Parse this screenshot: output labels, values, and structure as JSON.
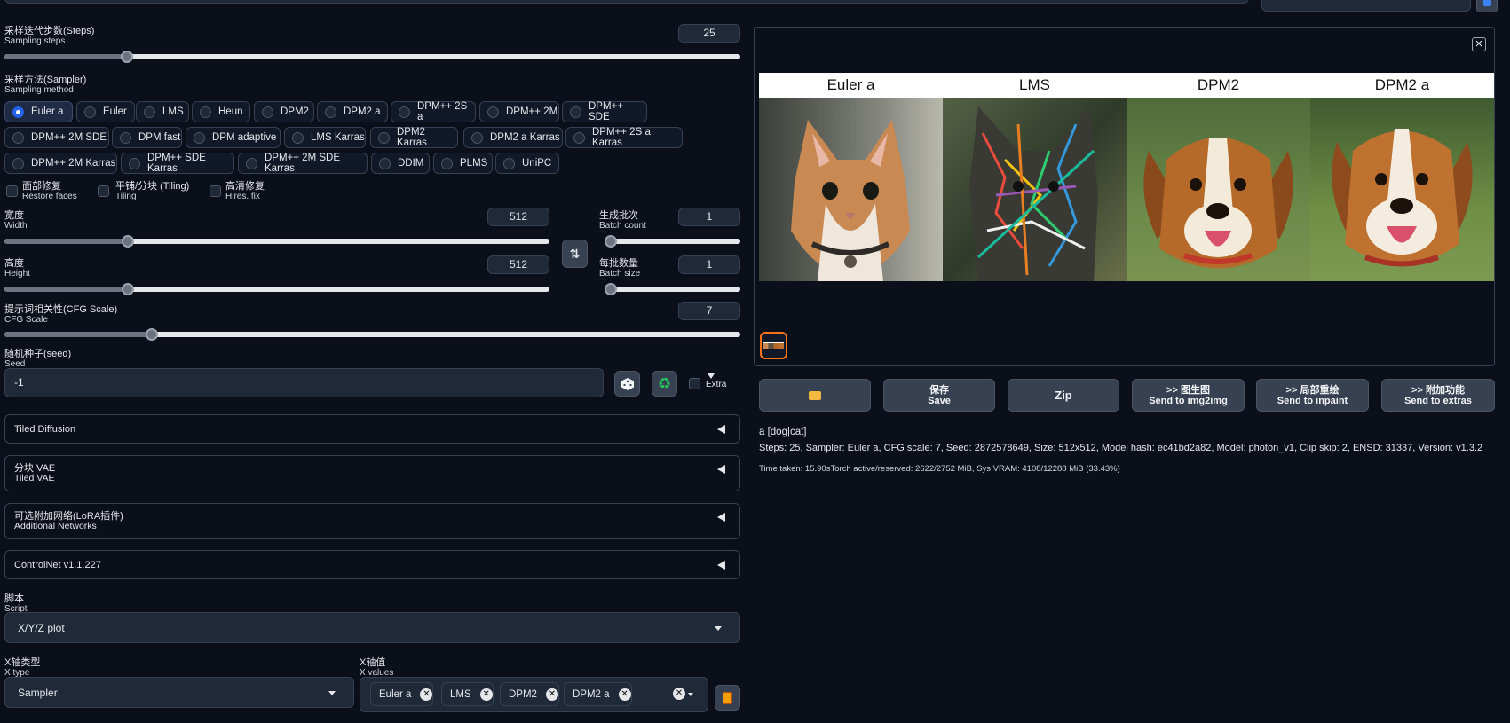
{
  "steps": {
    "label_cn": "采样迭代步数(Steps)",
    "label_en": "Sampling steps",
    "value": "25",
    "fraction": 0.167
  },
  "sampler": {
    "label_cn": "采样方法(Sampler)",
    "label_en": "Sampling method",
    "options": [
      "Euler a",
      "Euler",
      "LMS",
      "Heun",
      "DPM2",
      "DPM2 a",
      "DPM++ 2S a",
      "DPM++ 2M",
      "DPM++ SDE",
      "DPM++ 2M SDE",
      "DPM fast",
      "DPM adaptive",
      "LMS Karras",
      "DPM2 Karras",
      "DPM2 a Karras",
      "DPM++ 2S a Karras",
      "DPM++ 2M Karras",
      "DPM++ SDE Karras",
      "DPM++ 2M SDE Karras",
      "DDIM",
      "PLMS",
      "UniPC"
    ],
    "selected": "Euler a"
  },
  "checks": {
    "restore_faces": {
      "cn": "面部修复",
      "en": "Restore faces"
    },
    "tiling": {
      "cn": "平铺/分块 (Tiling)",
      "en": "Tiling"
    },
    "hires": {
      "cn": "高清修复",
      "en": "Hires. fix"
    }
  },
  "width": {
    "cn": "宽度",
    "en": "Width",
    "value": "512",
    "fraction": 0.226
  },
  "height": {
    "cn": "高度",
    "en": "Height",
    "value": "512",
    "fraction": 0.226
  },
  "batch_count": {
    "cn": "生成批次",
    "en": "Batch count",
    "value": "1",
    "fraction": 0.0
  },
  "batch_size": {
    "cn": "每批数量",
    "en": "Batch size",
    "value": "1",
    "fraction": 0.0
  },
  "cfg": {
    "cn": "提示词相关性(CFG Scale)",
    "en": "CFG Scale",
    "value": "7",
    "fraction": 0.2
  },
  "seed": {
    "cn": "随机种子(seed)",
    "en": "Seed",
    "value": "-1",
    "extra": "Extra"
  },
  "accordions": {
    "tiled_diffusion": "Tiled Diffusion",
    "tiled_vae_cn": "分块 VAE",
    "tiled_vae_en": "Tiled VAE",
    "networks_cn": "可选附加网络(LoRA插件)",
    "networks_en": "Additional Networks",
    "controlnet": "ControlNet v1.1.227"
  },
  "script": {
    "cn": "脚本",
    "en": "Script",
    "value": "X/Y/Z plot"
  },
  "xtype": {
    "cn": "X轴类型",
    "en": "X type",
    "value": "Sampler"
  },
  "xvalues": {
    "cn": "X轴值",
    "en": "X values",
    "tags": [
      "Euler a",
      "LMS",
      "DPM2",
      "DPM2 a"
    ]
  },
  "gallery": {
    "headers": [
      "Euler a",
      "LMS",
      "DPM2",
      "DPM2 a"
    ]
  },
  "actions": {
    "save_cn": "保存",
    "save_en": "Save",
    "zip": "Zip",
    "img2img_cn": ">> 图生图",
    "img2img_en": "Send to img2img",
    "inpaint_cn": ">> 局部重绘",
    "inpaint_en": "Send to inpaint",
    "extras_cn": ">> 附加功能",
    "extras_en": "Send to extras"
  },
  "output": {
    "prompt": "a [dog|cat]",
    "params": "Steps: 25, Sampler: Euler a, CFG scale: 7, Seed: 2872578649, Size: 512x512, Model hash: ec41bd2a82, Model: photon_v1, Clip skip: 2, ENSD: 31337, Version: v1.3.2",
    "time": "Time taken: 15.90sTorch active/reserved: 2622/2752 MiB, Sys VRAM: 4108/12288 MiB (33.43%)"
  },
  "colors": {
    "bg": "#0b0f19",
    "accent": "#2563eb",
    "thumb_border": "#f97316"
  }
}
